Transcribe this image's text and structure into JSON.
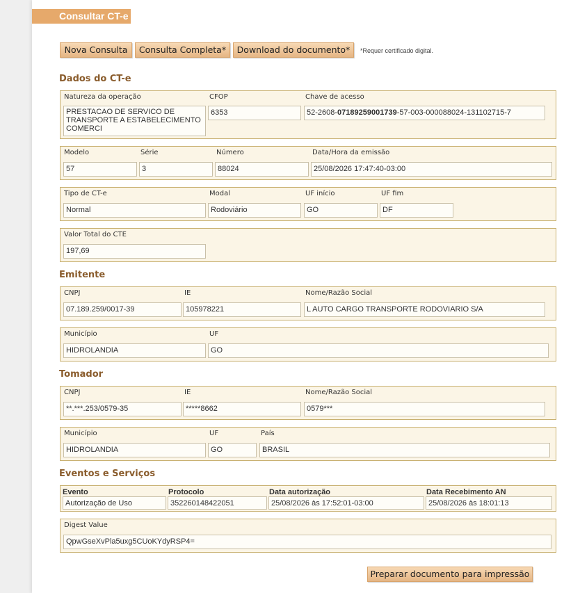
{
  "header": {
    "title": "Consultar CT-e"
  },
  "toolbar": {
    "nova_consulta": "Nova Consulta",
    "consulta_completa": "Consulta Completa*",
    "download": "Download do documento*",
    "note": "*Requer certificado digital."
  },
  "dados": {
    "title": "Dados do CT-e",
    "natureza_label": "Natureza da operação",
    "natureza_value": "PRESTACAO DE SERVICO DE TRANSPORTE A ESTABELECIMENTO COMERCI",
    "cfop_label": "CFOP",
    "cfop_value": "6353",
    "chave_label": "Chave de acesso",
    "chave_prefix": "52-2608-",
    "chave_bold": "07189259001739",
    "chave_suffix": "-57-003-000088024-131102715-7",
    "modelo_label": "Modelo",
    "modelo_value": "57",
    "serie_label": "Série",
    "serie_value": "3",
    "numero_label": "Número",
    "numero_value": "88024",
    "emissao_label": "Data/Hora da emissão",
    "emissao_value": "25/08/2026 17:47:40-03:00",
    "tipo_label": "Tipo de CT-e",
    "tipo_value": "Normal",
    "modal_label": "Modal",
    "modal_value": "Rodoviário",
    "uf_inicio_label": "UF início",
    "uf_inicio_value": "GO",
    "uf_fim_label": "UF fim",
    "uf_fim_value": "DF",
    "valor_label": "Valor Total do CTE",
    "valor_value": "197,69"
  },
  "emitente": {
    "title": "Emitente",
    "cnpj_label": "CNPJ",
    "cnpj_value": "07.189.259/0017-39",
    "ie_label": "IE",
    "ie_value": "105978221",
    "nome_label": "Nome/Razão Social",
    "nome_value": "L AUTO CARGO TRANSPORTE RODOVIARIO S/A",
    "municipio_label": "Município",
    "municipio_value": "HIDROLANDIA",
    "uf_label": "UF",
    "uf_value": "GO"
  },
  "tomador": {
    "title": "Tomador",
    "cnpj_label": "CNPJ",
    "cnpj_value": "**.***.253/0579-35",
    "ie_label": "IE",
    "ie_value": "*****8662",
    "nome_label": "Nome/Razão Social",
    "nome_value": "0579***",
    "municipio_label": "Município",
    "municipio_value": "HIDROLANDIA",
    "uf_label": "UF",
    "uf_value": "GO",
    "pais_label": "País",
    "pais_value": "BRASIL"
  },
  "eventos": {
    "title": "Eventos e Serviços",
    "col_evento": "Evento",
    "col_protocolo": "Protocolo",
    "col_data_aut": "Data autorização",
    "col_data_receb": "Data Recebimento AN",
    "evento_value": "Autorização de Uso",
    "protocolo_value": "352260148422051",
    "data_aut_value": "25/08/2026 às 17:52:01-03:00",
    "data_receb_value": "25/08/2026 às 18:01:13",
    "digest_label": "Digest Value",
    "digest_value": "QpwGseXvPla5uxg5CUoKYdyRSP4="
  },
  "footer": {
    "print_button": "Preparar documento para impressão"
  }
}
